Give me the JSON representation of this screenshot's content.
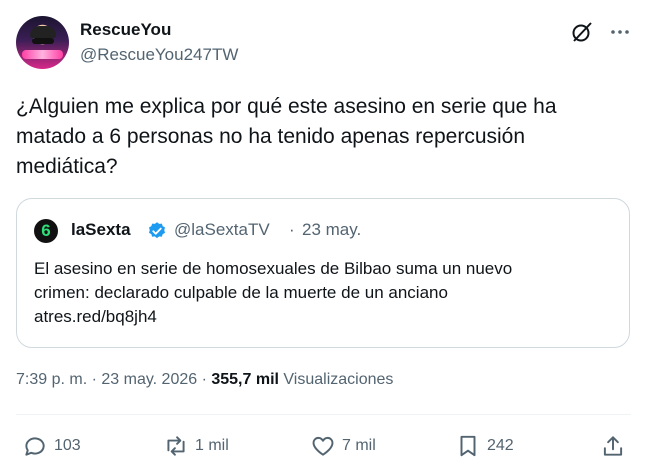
{
  "author": {
    "name": "RescueYou",
    "handle": "@RescueYou247TW",
    "avatar_icon": "avatar-image"
  },
  "header_icons": [
    "grok-icon",
    "more-icon"
  ],
  "tweet": {
    "text": "¿Alguien me explica por qué este asesino en serie que ha matado a 6 personas no ha tenido apenas repercusión mediática?"
  },
  "quote": {
    "name": "laSexta",
    "handle": "@laSextaTV",
    "separator": "·",
    "date": "23 may.",
    "logo_text": "6",
    "verified_color": "#1d9bf0",
    "line1": "El asesino en serie de homosexuales de Bilbao suma un nuevo",
    "line2": "crimen: declarado culpable de la muerte de un anciano",
    "link": "atres.red/bq8jh4"
  },
  "meta": {
    "time": "7:39 p. m.",
    "sep": " · ",
    "date": "23 may. 2026",
    "sep2": " · ",
    "views_count": "355,7 mil",
    "views_label": "Visualizaciones"
  },
  "actions": {
    "replies": "103",
    "reposts": "1 mil",
    "likes": "7 mil",
    "bookmarks": "242"
  }
}
